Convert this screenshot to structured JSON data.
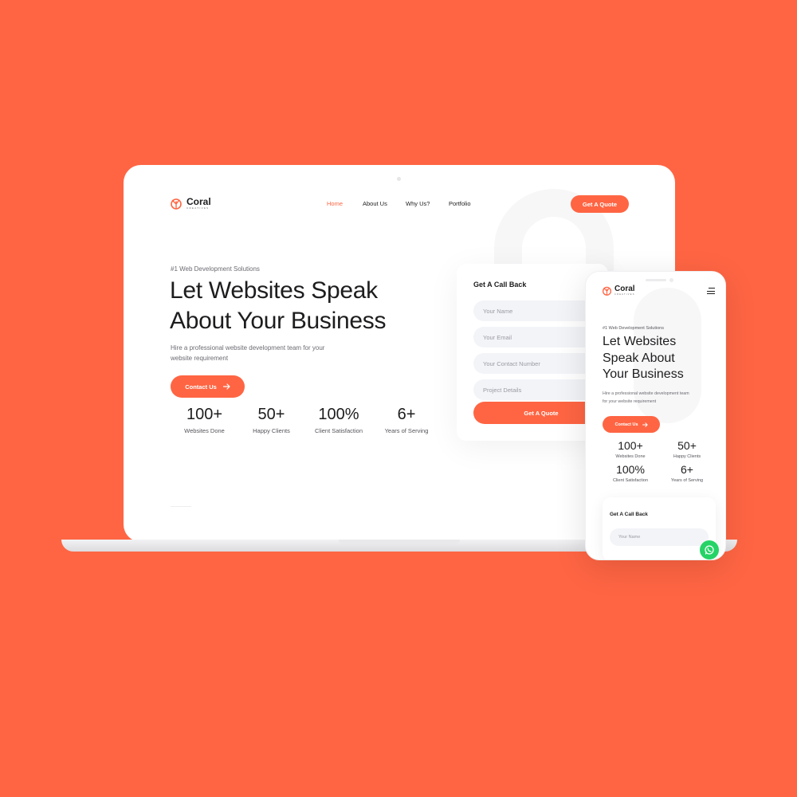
{
  "brand": {
    "name": "Coral",
    "subtitle": "CREATIVES",
    "accent_color": "#ff6543"
  },
  "nav": {
    "items": [
      {
        "label": "Home",
        "active": true
      },
      {
        "label": "About Us",
        "active": false
      },
      {
        "label": "Why Us?",
        "active": false
      },
      {
        "label": "Portfolio",
        "active": false
      }
    ],
    "cta_label": "Get A Quote"
  },
  "hero": {
    "tag": "#1 Web Development Solutions",
    "title_line1": "Let Websites Speak",
    "title_line2": "About Your Business",
    "subtitle_line1": "Hire a professional website development team for your",
    "subtitle_line2": "website requirement",
    "cta_label": "Contact Us",
    "cta_icon": "arrow-right-icon"
  },
  "stats": [
    {
      "value": "100+",
      "label": "Websites Done"
    },
    {
      "value": "50+",
      "label": "Happy Clients"
    },
    {
      "value": "100%",
      "label": "Client Satisfaction"
    },
    {
      "value": "6+",
      "label": "Years of Serving"
    }
  ],
  "form": {
    "title": "Get A Call Back",
    "fields": [
      {
        "placeholder": "Your Name"
      },
      {
        "placeholder": "Your Email"
      },
      {
        "placeholder": "Your Contact Number"
      },
      {
        "placeholder": "Project Details"
      }
    ],
    "submit_label": "Get A Quote"
  },
  "mobile": {
    "tag": "#1 Web Development Solutions",
    "title_line1": "Let Websites",
    "title_line2": "Speak About",
    "title_line3": "Your Business",
    "subtitle_line1": "Hire a professional website development team",
    "subtitle_line2": "for your website requirement",
    "cta_label": "Contact Us",
    "form_title": "Get A Call Back",
    "form_field_placeholder": "Your Name",
    "menu_icon": "hamburger-menu-icon",
    "chat_icon": "whatsapp-icon"
  }
}
